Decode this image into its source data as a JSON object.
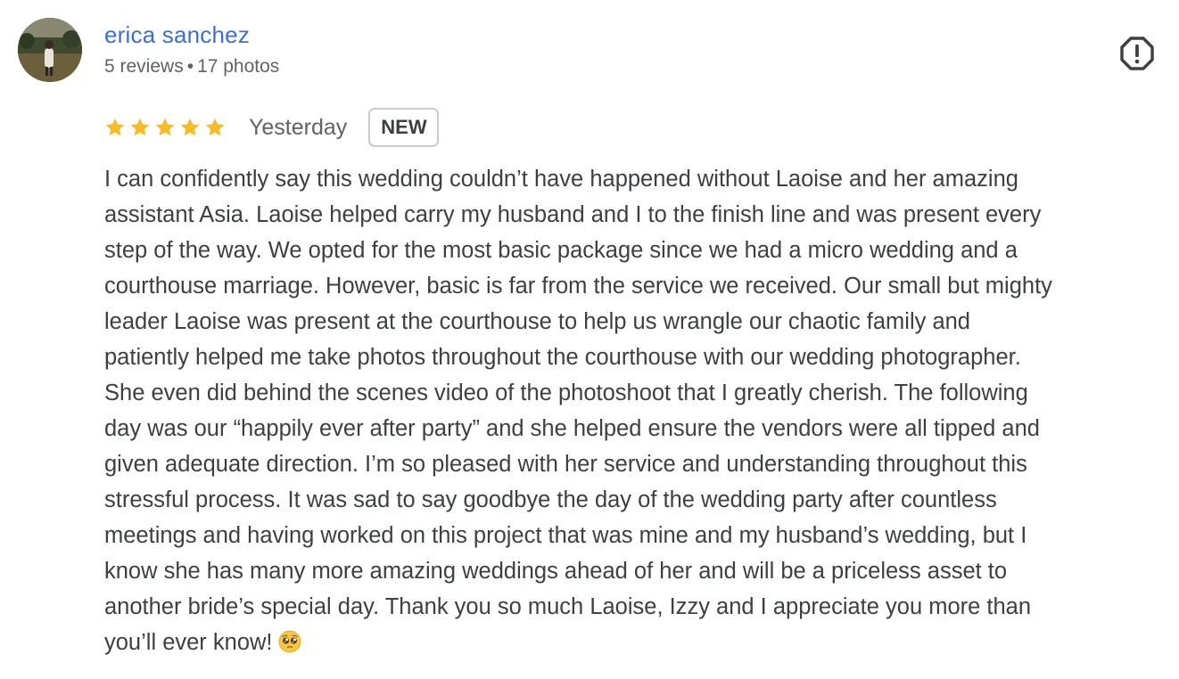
{
  "reviewer": {
    "name": "erica sanchez",
    "reviews": "5 reviews",
    "separator": "•",
    "photos": "17 photos"
  },
  "report_icon": "report-icon",
  "rating": {
    "stars": 5,
    "max_stars": 5,
    "star_color": "#f6bb2b",
    "date": "Yesterday",
    "badge": "NEW"
  },
  "review": {
    "lines": [
      "I can confidently say this wedding couldn’t have happened without Laoise and her amazing",
      "assistant Asia. Laoise helped carry my husband and I to the finish line and was present every",
      "step of the way. We opted for the most basic package since we had a micro wedding and a",
      "courthouse marriage. However, basic is far from the service we received. Our small but mighty",
      "leader Laoise was present at the courthouse to help us wrangle our chaotic family and",
      "patiently helped me take photos throughout the courthouse with our wedding photographer.",
      "She even did behind the scenes video of the photoshoot that I greatly cherish. The following",
      "day was our “happily ever after party” and she helped ensure the vendors were all tipped and",
      "given adequate direction. I’m so pleased with her service and understanding throughout this",
      "stressful process. It was sad to say goodbye the day of the wedding party after countless",
      "meetings and having worked on this project that was mine and my husband’s wedding, but I",
      "know she has many more amazing weddings ahead of her and will be a priceless asset to",
      "another bride’s special day. Thank you so much Laoise, Izzy and I appreciate you more than",
      "you’ll ever know!"
    ],
    "trailing_emoji": "pleading-face-emoji"
  }
}
